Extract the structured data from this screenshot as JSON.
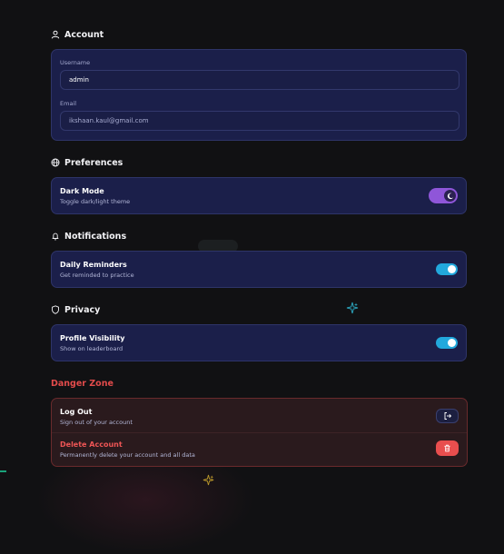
{
  "sections": {
    "account": {
      "title": "Account",
      "icon": "user-icon"
    },
    "preferences": {
      "title": "Preferences",
      "icon": "globe-icon"
    },
    "notifications": {
      "title": "Notifications",
      "icon": "bell-icon"
    },
    "privacy": {
      "title": "Privacy",
      "icon": "shield-icon"
    },
    "danger": {
      "title": "Danger Zone"
    }
  },
  "account": {
    "username_label": "Username",
    "username_value": "admin",
    "email_label": "Email",
    "email_value": "ikshaan.kaul@gmail.com"
  },
  "preferences": {
    "dark_mode_title": "Dark Mode",
    "dark_mode_desc": "Toggle dark/light theme",
    "dark_mode_on": true
  },
  "notifications": {
    "reminders_title": "Daily Reminders",
    "reminders_desc": "Get reminded to practice",
    "reminders_on": true
  },
  "privacy": {
    "visibility_title": "Profile Visibility",
    "visibility_desc": "Show on leaderboard",
    "visibility_on": true
  },
  "danger": {
    "logout_title": "Log Out",
    "logout_desc": "Sign out of your account",
    "delete_title": "Delete Account",
    "delete_desc": "Permanently delete your account and all data"
  },
  "colors": {
    "background": "#111113",
    "card": "#1b1f4a",
    "toggle_on": "#22a8dc",
    "dark_toggle": "#8f56d9",
    "danger": "#e84e4e"
  }
}
